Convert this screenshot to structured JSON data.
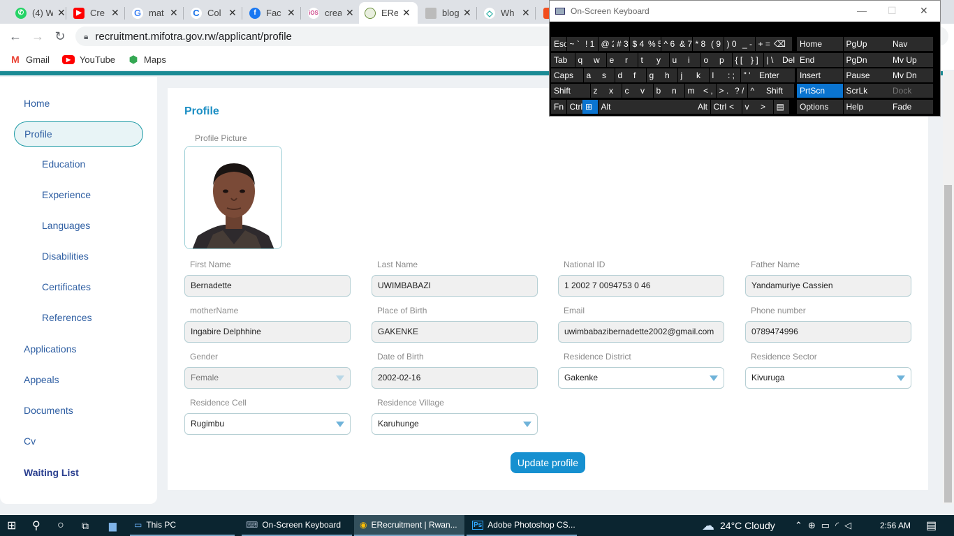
{
  "browser": {
    "tabs": [
      {
        "label": "(4) W",
        "icon": "whatsapp-icon",
        "color": "#25d366"
      },
      {
        "label": "Cre",
        "icon": "youtube-icon",
        "color": "#ff0000"
      },
      {
        "label": "mat",
        "icon": "google-icon",
        "color": "#4285f4"
      },
      {
        "label": "Col",
        "icon": "google-c-icon",
        "color": "#1a73e8"
      },
      {
        "label": "Fac",
        "icon": "facebook-icon",
        "color": "#1877f2"
      },
      {
        "label": "crea",
        "icon": "ios-icon",
        "color": "#c48"
      },
      {
        "label": "ERe",
        "icon": "rwanda-seal-icon",
        "color": "#6a8f3a"
      },
      {
        "label": "blog",
        "icon": "blog-icon",
        "color": "#999"
      },
      {
        "label": "Wh",
        "icon": "code-icon",
        "color": "#2bb0a6"
      },
      {
        "label": "",
        "icon": "figma-icon",
        "color": "#f24e1e"
      }
    ],
    "url": "recruitment.mifotra.gov.rw/applicant/profile",
    "bookmarks": [
      {
        "label": "Gmail",
        "icon": "gmail-icon"
      },
      {
        "label": "YouTube",
        "icon": "youtube-icon"
      },
      {
        "label": "Maps",
        "icon": "maps-icon"
      }
    ]
  },
  "sidebar": {
    "home": "Home",
    "profile": "Profile",
    "education": "Education",
    "experience": "Experience",
    "languages": "Languages",
    "disabilities": "Disabilities",
    "certificates": "Certificates",
    "references": "References",
    "applications": "Applications",
    "appeals": "Appeals",
    "documents": "Documents",
    "cv": "Cv",
    "waiting_list": "Waiting List"
  },
  "profile": {
    "title": "Profile",
    "picture_label": "Profile Picture",
    "fields": {
      "first_name": {
        "label": "First Name",
        "value": "Bernadette"
      },
      "last_name": {
        "label": "Last Name",
        "value": "UWIMBABAZI"
      },
      "national_id": {
        "label": "National ID",
        "value": "1 2002 7 0094753 0 46"
      },
      "father_name": {
        "label": "Father Name",
        "value": "Yandamuriye Cassien"
      },
      "mother_name": {
        "label": "motherName",
        "value": "Ingabire Delphhine"
      },
      "place_of_birth": {
        "label": "Place of Birth",
        "value": "GAKENKE"
      },
      "email": {
        "label": "Email",
        "value": "uwimbabazibernadette2002@gmail.com"
      },
      "phone": {
        "label": "Phone number",
        "value": "0789474996"
      },
      "gender": {
        "label": "Gender",
        "value": "Female"
      },
      "dob": {
        "label": "Date of Birth",
        "value": "2002-02-16"
      },
      "district": {
        "label": "Residence District",
        "value": "Gakenke"
      },
      "sector": {
        "label": "Residence Sector",
        "value": "Kivuruga"
      },
      "cell": {
        "label": "Residence Cell",
        "value": "Rugimbu"
      },
      "village": {
        "label": "Residence Village",
        "value": "Karuhunge"
      }
    },
    "update_button": "Update profile"
  },
  "osk": {
    "title": "On-Screen Keyboard",
    "rows": [
      [
        "Esc",
        "~ `",
        "! 1",
        "@ 2",
        "# 3",
        "$ 4",
        "% 5",
        "^ 6",
        "& 7",
        "* 8",
        "( 9",
        ") 0",
        "_ -",
        "+ =",
        "⌫",
        "Home",
        "PgUp",
        "Nav"
      ],
      [
        "Tab",
        "q",
        "w",
        "e",
        "r",
        "t",
        "y",
        "u",
        "i",
        "o",
        "p",
        "{ [",
        "} ]",
        "| \\",
        "Del",
        "End",
        "PgDn",
        "Mv Up"
      ],
      [
        "Caps",
        "a",
        "s",
        "d",
        "f",
        "g",
        "h",
        "j",
        "k",
        "l",
        ": ;",
        "\" '",
        "Enter",
        "Insert",
        "Pause",
        "Mv Dn"
      ],
      [
        "Shift",
        "z",
        "x",
        "c",
        "v",
        "b",
        "n",
        "m",
        "< ,",
        "> .",
        "? /",
        "^",
        "Shift",
        "PrtScn",
        "ScrLk",
        "Dock"
      ],
      [
        "Fn",
        "Ctrl",
        "⊞",
        "Alt",
        "Alt",
        "Ctrl",
        "<",
        "v",
        ">",
        "▤",
        "Options",
        "Help",
        "Fade"
      ]
    ]
  },
  "taskbar": {
    "apps": [
      {
        "label": "This PC"
      },
      {
        "label": "On-Screen Keyboard"
      },
      {
        "label": "ERecruitment | Rwan..."
      },
      {
        "label": "Adobe Photoshop CS..."
      }
    ],
    "weather": "24°C  Cloudy",
    "time": "2:56 AM"
  }
}
